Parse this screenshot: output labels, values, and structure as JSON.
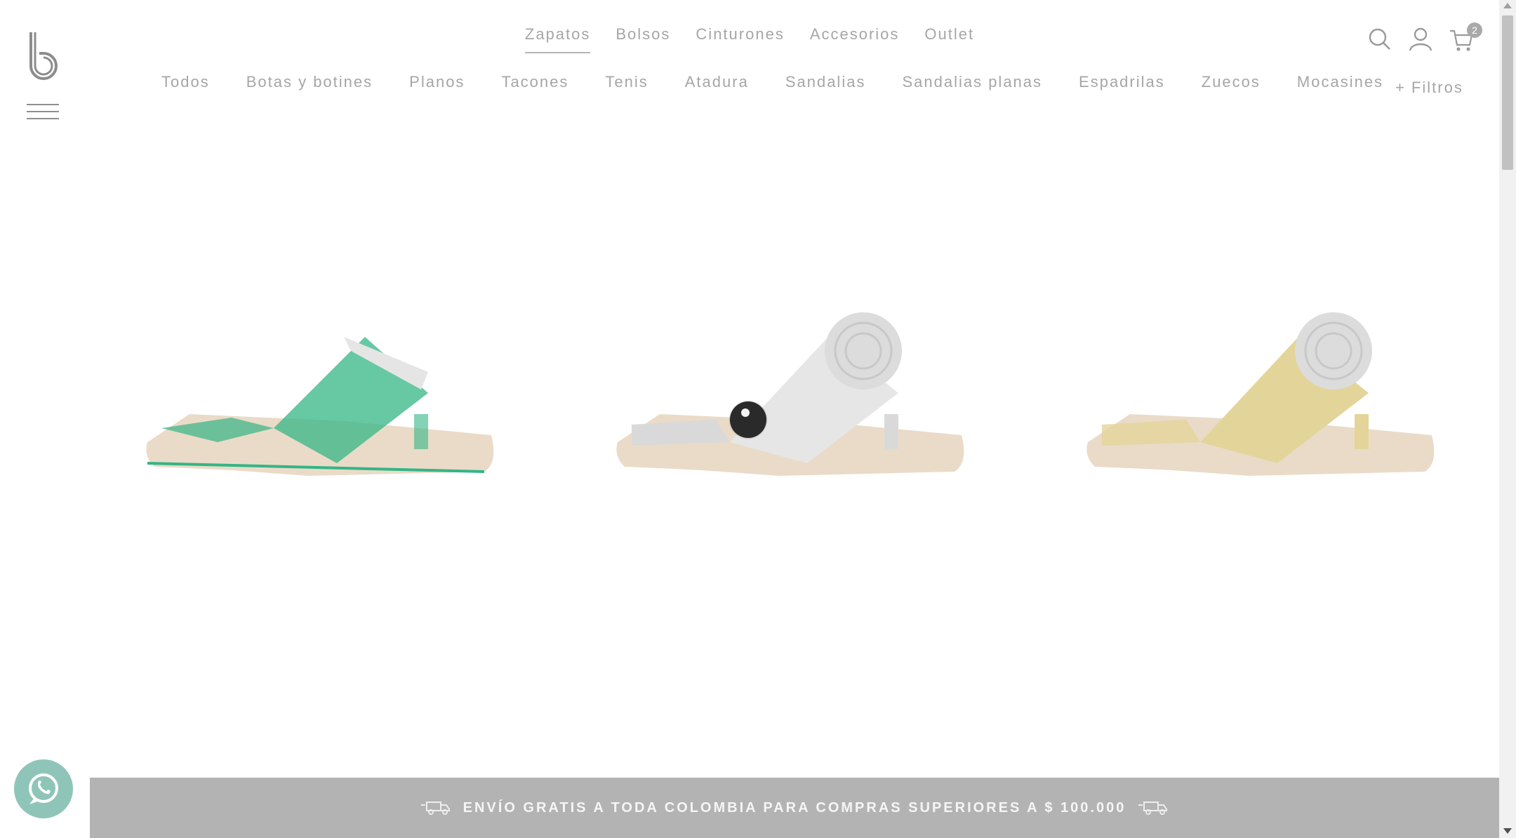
{
  "header": {
    "logo_letter": "b",
    "top_nav": [
      "Zapatos",
      "Bolsos",
      "Cinturones",
      "Accesorios",
      "Outlet"
    ],
    "active_top_nav": "Zapatos",
    "sub_nav": [
      "Todos",
      "Botas y botines",
      "Planos",
      "Tacones",
      "Tenis",
      "Atadura",
      "Sandalias",
      "Sandalias planas",
      "Espadrilas",
      "Zuecos",
      "Mocasines"
    ],
    "filters_label": "+ Filtros",
    "cart_count": "2",
    "icons": [
      "search-icon",
      "user-icon",
      "cart-icon",
      "menu-icon"
    ]
  },
  "products": [
    {
      "color": "#34b585"
    },
    {
      "color": "#d9d9d9"
    },
    {
      "color": "#e3d59a"
    }
  ],
  "banner": {
    "text": "ENVÍO GRATIS A TODA COLOMBIA PARA COMPRAS SUPERIORES A $ 100.000"
  },
  "colors": {
    "whatsapp": "#8fc5b8",
    "banner_bg": "#b3b3b3"
  }
}
